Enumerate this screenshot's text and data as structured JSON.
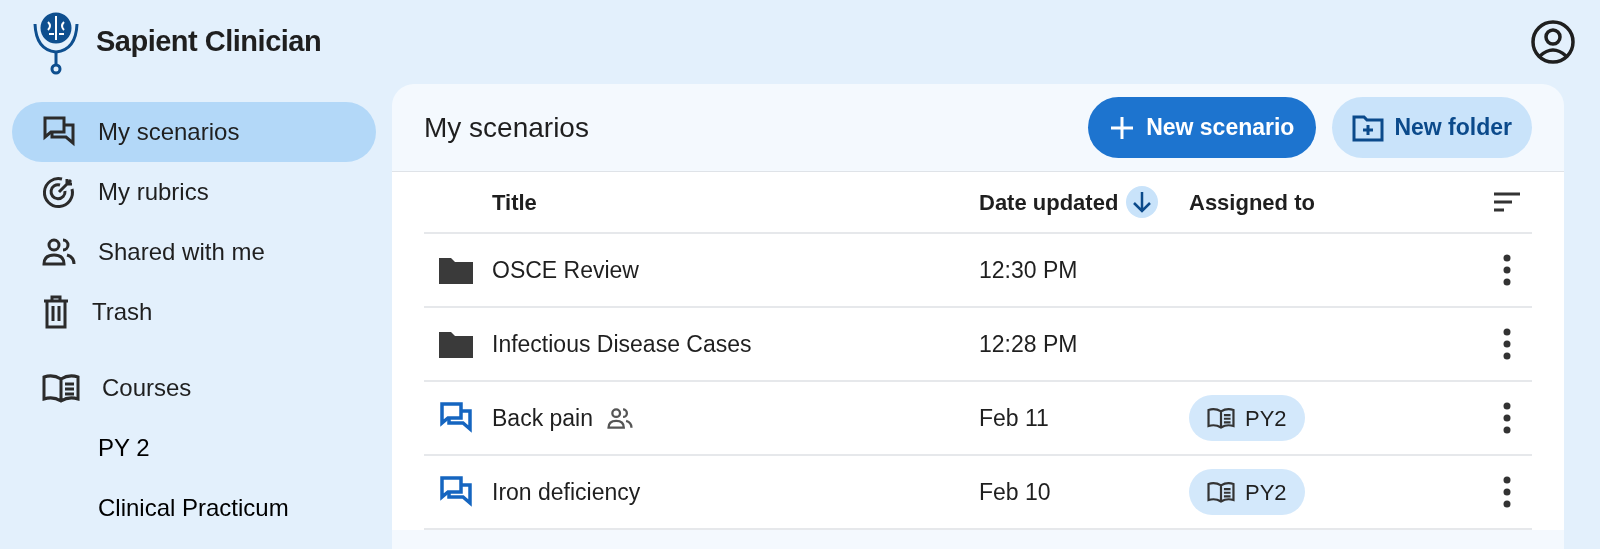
{
  "app": {
    "title": "Sapient Clinician"
  },
  "sidebar": {
    "items": [
      {
        "label": "My scenarios",
        "selected": true
      },
      {
        "label": "My rubrics",
        "selected": false
      },
      {
        "label": "Shared with me",
        "selected": false
      },
      {
        "label": "Trash",
        "selected": false
      }
    ],
    "courses": {
      "label": "Courses",
      "items": [
        {
          "label": "PY 2",
          "selected": false
        },
        {
          "label": "Clinical Practicum",
          "selected": false
        }
      ]
    }
  },
  "main": {
    "title": "My scenarios",
    "buttons": [
      {
        "label": "New scenario",
        "kind": "primary"
      },
      {
        "label": "New folder",
        "kind": "folder"
      }
    ]
  },
  "table": {
    "columns": [
      {
        "label": "Title",
        "sorted": false
      },
      {
        "label": "Date updated",
        "sorted": true
      },
      {
        "label": "Assigned to",
        "sorted": false
      }
    ],
    "rows": [
      {
        "kind": "folder",
        "title": "OSCE Review",
        "shared": false,
        "date": "12:30 PM"
      },
      {
        "kind": "folder",
        "title": "Infectious Disease Cases",
        "shared": false,
        "date": "12:28 PM"
      },
      {
        "kind": "scenario",
        "title": "Back pain",
        "shared": true,
        "date": "Feb 11",
        "course": "PY2"
      },
      {
        "kind": "scenario",
        "title": "Iron deficiency",
        "shared": false,
        "date": "Feb 10",
        "course": "PY2"
      }
    ]
  }
}
